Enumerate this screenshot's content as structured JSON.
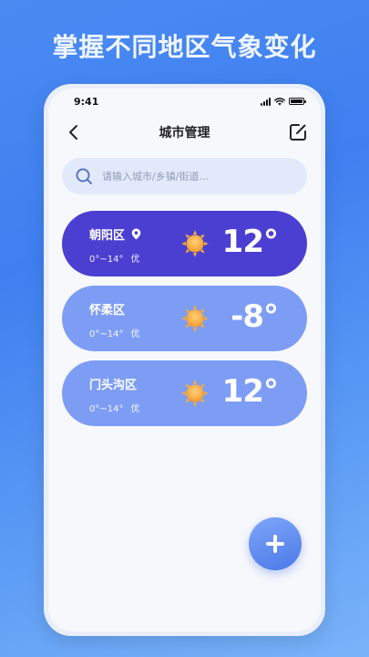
{
  "promo": {
    "title": "掌握不同地区气象变化"
  },
  "status_bar": {
    "time": "9:41"
  },
  "header": {
    "title": "城市管理"
  },
  "search": {
    "placeholder": "请输入城市/乡镇/街道..."
  },
  "cities": [
    {
      "name": "朝阳区",
      "range": "0°~14°",
      "quality": "优",
      "temp": "12°",
      "condition": "sunny",
      "active": true,
      "located": true
    },
    {
      "name": "怀柔区",
      "range": "0°~14°",
      "quality": "优",
      "temp": "-8°",
      "condition": "sunny",
      "active": false,
      "located": false
    },
    {
      "name": "门头沟区",
      "range": "0°~14°",
      "quality": "优",
      "temp": "12°",
      "condition": "sunny",
      "active": false,
      "located": false
    }
  ],
  "icons": {
    "back": "chevron-left-icon",
    "edit": "edit-icon",
    "search": "search-icon",
    "location": "location-pin-icon",
    "weather": "sun-icon",
    "add": "plus-icon"
  },
  "colors": {
    "active_card": "#4a3fd1",
    "inactive_card": "#7d9df5",
    "search_bg": "#e2e9fb",
    "add_button": "#5f8cf0"
  }
}
